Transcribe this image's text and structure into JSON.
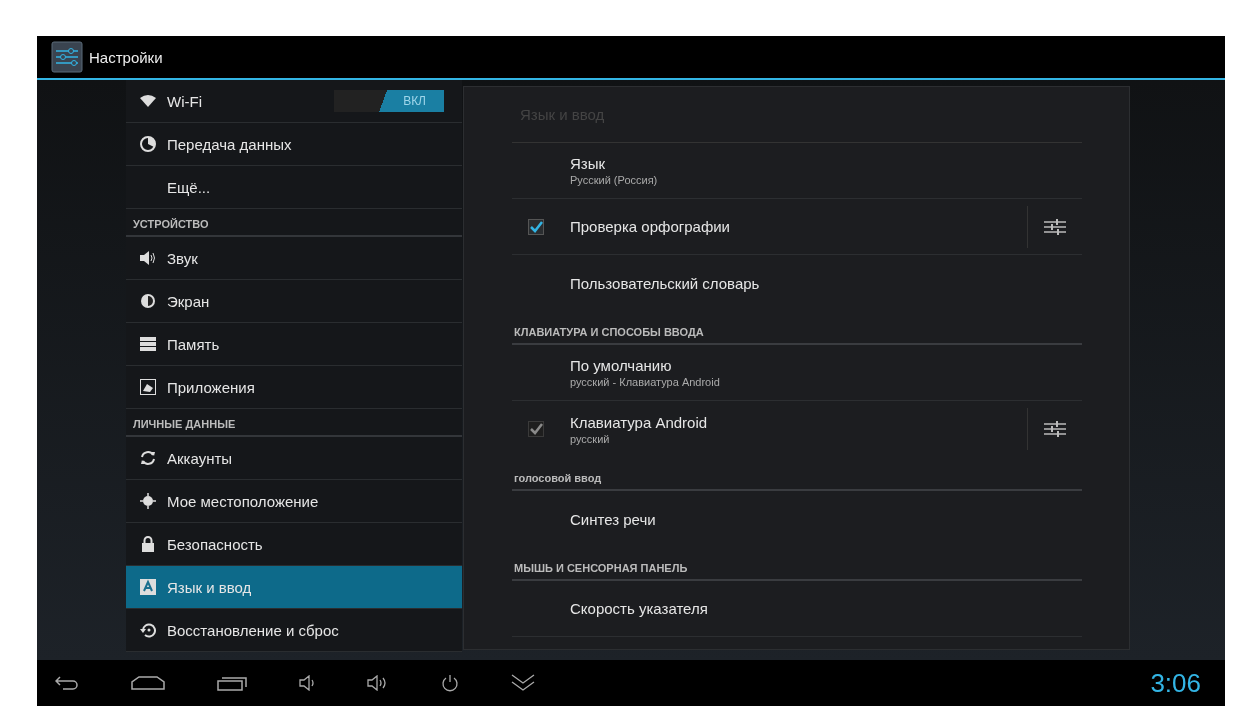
{
  "app_bar": {
    "title": "Настройки"
  },
  "sidebar": {
    "items": [
      {
        "kind": "toggle_item",
        "label": "Wi-Fi",
        "selected": false,
        "toggle": {
          "label": "ВКЛ",
          "on": true
        }
      },
      {
        "kind": "item",
        "label": "Передача данных",
        "selected": false
      },
      {
        "kind": "item",
        "label": "Ещё...",
        "selected": false
      },
      {
        "kind": "header",
        "label": "УСТРОЙСТВО"
      },
      {
        "kind": "item",
        "label": "Звук",
        "selected": false
      },
      {
        "kind": "item",
        "label": "Экран",
        "selected": false
      },
      {
        "kind": "item",
        "label": "Память",
        "selected": false
      },
      {
        "kind": "item",
        "label": "Приложения",
        "selected": false
      },
      {
        "kind": "header",
        "label": "ЛИЧНЫЕ ДАННЫЕ"
      },
      {
        "kind": "item",
        "label": "Аккаунты",
        "selected": false
      },
      {
        "kind": "item",
        "label": "Мое местоположение",
        "selected": false
      },
      {
        "kind": "item",
        "label": "Безопасность",
        "selected": false
      },
      {
        "kind": "item",
        "label": "Язык и ввод",
        "selected": true
      },
      {
        "kind": "item",
        "label": "Восстановление и сброс",
        "selected": false
      }
    ]
  },
  "panel": {
    "title": "Язык и ввод",
    "items": [
      {
        "kind": "pref",
        "title": "Язык",
        "summary": "Русский (Россия)"
      },
      {
        "kind": "checkbox_pref",
        "title": "Проверка орфографии",
        "checked": true,
        "disabled": false
      },
      {
        "kind": "pref",
        "title": "Пользовательский словарь"
      },
      {
        "kind": "header",
        "title": "КЛАВИАТУРА И СПОСОБЫ ВВОДА"
      },
      {
        "kind": "pref",
        "title": "По умолчанию",
        "summary": "русский - Клавиатура Android"
      },
      {
        "kind": "checkbox_pref",
        "title": "Клавиатура Android",
        "summary": "русский",
        "checked": true,
        "disabled": true
      },
      {
        "kind": "header",
        "title": "голосовой ввод"
      },
      {
        "kind": "pref",
        "title": "Синтез речи"
      },
      {
        "kind": "header",
        "title": "МЫШЬ И СЕНСОРНАЯ ПАНЕЛЬ"
      },
      {
        "kind": "pref",
        "title": "Скорость указателя"
      }
    ]
  },
  "nav_bar": {
    "clock": "3:06"
  }
}
